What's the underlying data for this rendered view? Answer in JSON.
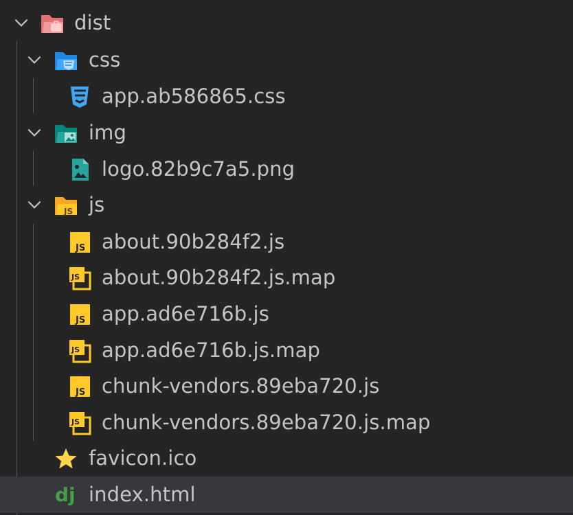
{
  "explorer": {
    "dist": {
      "label": "dist",
      "expanded": true,
      "icon": "folder-dist-open-icon",
      "css": {
        "label": "css",
        "expanded": true,
        "icon": "folder-css-open-icon",
        "files": [
          {
            "label": "app.ab586865.css",
            "icon": "css3-icon"
          }
        ]
      },
      "img": {
        "label": "img",
        "expanded": true,
        "icon": "folder-images-open-icon",
        "files": [
          {
            "label": "logo.82b9c7a5.png",
            "icon": "image-file-icon"
          }
        ]
      },
      "js": {
        "label": "js",
        "expanded": true,
        "icon": "folder-js-open-icon",
        "files": [
          {
            "label": "about.90b284f2.js",
            "icon": "javascript-icon"
          },
          {
            "label": "about.90b284f2.js.map",
            "icon": "javascript-map-icon"
          },
          {
            "label": "app.ad6e716b.js",
            "icon": "javascript-icon"
          },
          {
            "label": "app.ad6e716b.js.map",
            "icon": "javascript-map-icon"
          },
          {
            "label": "chunk-vendors.89eba720.js",
            "icon": "javascript-icon"
          },
          {
            "label": "chunk-vendors.89eba720.js.map",
            "icon": "javascript-map-icon"
          }
        ]
      },
      "files": [
        {
          "label": "favicon.ico",
          "icon": "star-icon"
        },
        {
          "label": "index.html",
          "icon": "django-icon",
          "selected": true
        }
      ]
    }
  },
  "colors": {
    "background": "#252526",
    "selected_row": "#37373d",
    "text": "#c5c5c5",
    "chevron": "#c5c5c5",
    "indent_guide": "#585858",
    "dist_folder": "#e57373",
    "css_folder": "#42a5f5",
    "img_folder": "#26a69a",
    "js_folder": "#ffca28",
    "js_icon": "#ffca28",
    "django_icon": "#43a047",
    "star_icon": "#ffd54f"
  }
}
